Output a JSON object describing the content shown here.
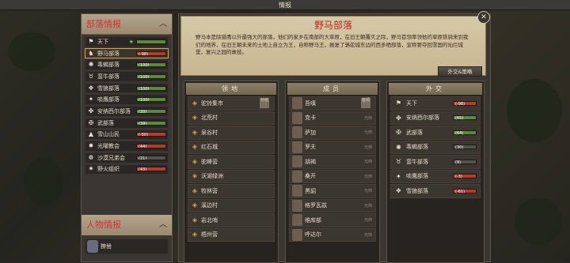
{
  "window_title": "情报",
  "tribe_section": {
    "title": "部落情报",
    "chevron": "︿"
  },
  "tribes": [
    {
      "icon": "banner-icon",
      "glyph": "⚑",
      "name": "天下",
      "star": true,
      "bar": "",
      "bar_color": "green",
      "selected": false
    },
    {
      "icon": "horse-icon",
      "glyph": "♞",
      "name": "野马部落",
      "bar": "(-98)",
      "bar_color": "red",
      "selected": true
    },
    {
      "icon": "scorpion-icon",
      "glyph": "✺",
      "name": "毒蝎部落",
      "bar": "(100)",
      "bar_color": "green",
      "selected": false
    },
    {
      "icon": "bull-icon",
      "glyph": "♉",
      "name": "蛮牛部落",
      "bar": "(100)",
      "bar_color": "green",
      "selected": false
    },
    {
      "icon": "wolf-icon",
      "glyph": "❖",
      "name": "雪狼部落",
      "bar": "(100)",
      "bar_color": "green",
      "selected": false
    },
    {
      "icon": "eagle-icon",
      "glyph": "✦",
      "name": "啖鹰部落",
      "bar": "(100)",
      "bar_color": "green",
      "selected": false
    },
    {
      "icon": "crest-icon",
      "glyph": "✤",
      "name": "安纳西尔部落",
      "bar": "(20)",
      "bar_color": "green",
      "selected": false
    },
    {
      "icon": "warrior-icon",
      "glyph": "✠",
      "name": "武部落",
      "bar": "(39)",
      "bar_color": "green",
      "selected": false
    },
    {
      "icon": "mountain-icon",
      "glyph": "▲",
      "name": "雪山山民",
      "bar": "(-50)",
      "bar_color": "red",
      "selected": false
    },
    {
      "icon": "light-icon",
      "glyph": "✹",
      "name": "光曜教会",
      "bar": "(44)",
      "bar_color": "red",
      "selected": false
    },
    {
      "icon": "desert-icon",
      "glyph": "☸",
      "name": "沙漠兄弟会",
      "bar": "(21)",
      "bar_color": "gray",
      "selected": false
    },
    {
      "icon": "fire-icon",
      "glyph": "✷",
      "name": "野火组织",
      "bar": "(43)",
      "bar_color": "red",
      "selected": false
    }
  ],
  "people_section": {
    "title": "人物情报",
    "chevron": "︿"
  },
  "people": [
    {
      "name": "獠凿"
    }
  ],
  "tribe_info": {
    "title": "野马部落",
    "description": "野马本是除猎鹰以外最强大的部落，他们的家乡在南部的大草原，在旧王朝覆灭之际，野马首领率领他的草原铁骑来到我们的地界，在旧王朝未来的土地上自立为王，自称野马王，报复了骆驼城东边的西多栖部落，宣称要夺回雪国的灿烂城堡，复兴之园的故技。",
    "diplomacy_button": "外交&策略"
  },
  "territory": {
    "title": "领地",
    "items": [
      "驼铃集市",
      "北荒村",
      "泉谷村",
      "红石城",
      "驼峰营",
      "沃湖绿洲",
      "牧林营",
      "溪边村",
      "岩北哨",
      "梧州营"
    ],
    "first_tag": "补给"
  },
  "members": {
    "title": "成员",
    "items": [
      {
        "name": "吾嗔",
        "role": ""
      },
      {
        "name": "克卡",
        "role": "元帅"
      },
      {
        "name": "萨加",
        "role": "元帅"
      },
      {
        "name": "罗夫",
        "role": "元帅"
      },
      {
        "name": "胡褐",
        "role": "元帅"
      },
      {
        "name": "桑开",
        "role": "元帅"
      },
      {
        "name": "黑貂",
        "role": "元帅"
      },
      {
        "name": "格罗瓦兹",
        "role": "元帅"
      },
      {
        "name": "维库部",
        "role": "元帅"
      },
      {
        "name": "呼达尔",
        "role": "元帅"
      }
    ],
    "first_tag": "首领"
  },
  "diplomacy": {
    "title": "外交",
    "items": [
      {
        "icon": "banner-icon",
        "glyph": "⚑",
        "name": "天下",
        "value": "(-98)",
        "color": "red"
      },
      {
        "icon": "crest-icon",
        "glyph": "✤",
        "name": "安纳西尔部落",
        "value": "(65)",
        "color": "green"
      },
      {
        "icon": "warrior-icon",
        "glyph": "✠",
        "name": "武部落",
        "value": "(64)",
        "color": "green"
      },
      {
        "icon": "scorpion-icon",
        "glyph": "✺",
        "name": "毒蝎部落",
        "value": "(30)",
        "color": "gray"
      },
      {
        "icon": "bull-icon",
        "glyph": "♉",
        "name": "蛮牛部落",
        "value": "(9)",
        "color": "gray"
      },
      {
        "icon": "eagle-icon",
        "glyph": "✦",
        "name": "啖鹰部落",
        "value": "(-3)",
        "color": "red"
      },
      {
        "icon": "wolf-icon",
        "glyph": "❖",
        "name": "雪狼部落",
        "value": "(-61)",
        "color": "red"
      }
    ]
  },
  "close_glyph": "✕"
}
